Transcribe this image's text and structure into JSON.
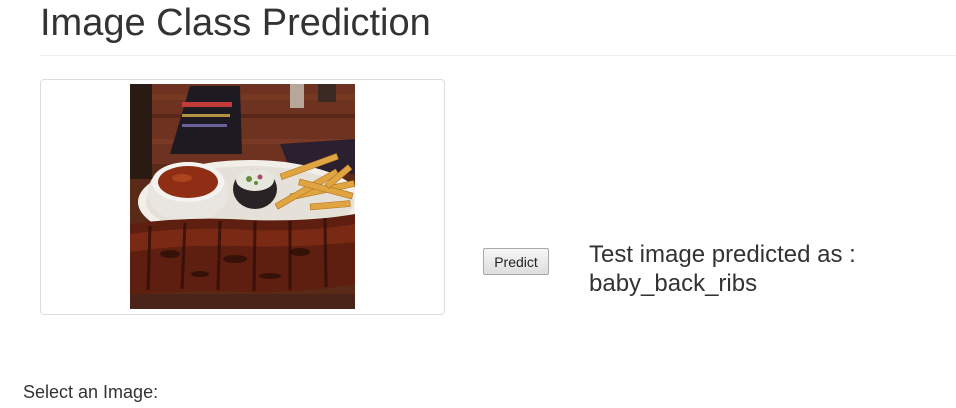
{
  "page": {
    "title": "Image Class Prediction"
  },
  "preview": {
    "image_subject": "baby back ribs with fries, coleslaw and dipping sauce"
  },
  "actions": {
    "predict_label": "Predict"
  },
  "result": {
    "prefix": "Test image predicted as :",
    "label": "baby_back_ribs"
  },
  "form": {
    "select_label": "Select an Image:"
  }
}
